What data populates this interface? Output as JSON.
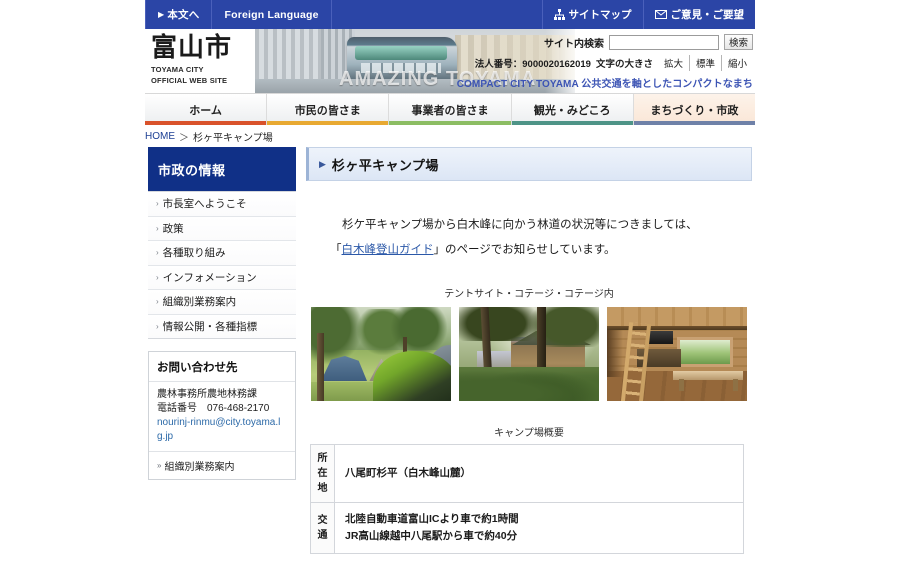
{
  "utility_bar": {
    "left_items": [
      {
        "label": "本文へ",
        "icon": "caret-right-icon"
      },
      {
        "label": "Foreign Language",
        "icon": ""
      }
    ],
    "right_items": [
      {
        "label": "サイトマップ",
        "icon": "sitemap-icon"
      },
      {
        "label": "ご意見・ご要望",
        "icon": "mail-icon"
      }
    ],
    "background": "#2b45a6"
  },
  "masthead": {
    "logo_kanji": "富山市",
    "logo_en_line1": "TOYAMA CITY",
    "logo_en_line2": "OFFICIAL WEB SITE",
    "banner_text": "AMAZING TOYAMA",
    "search": {
      "label": "サイト内検索",
      "value": "",
      "placeholder": "",
      "button_label": "検索"
    },
    "corporate_number": "法人番号：9000020162019",
    "text_size_label": "文字の大きさ",
    "text_size_buttons": [
      "拡大",
      "標準",
      "縮小"
    ],
    "tagline": "COMPACT CITY TOYAMA 公共交通を軸としたコンパクトなまちづくり",
    "tagline_color": "#3c54b4"
  },
  "global_nav": {
    "items": [
      {
        "label": "ホーム",
        "bar_color": "#d9522b",
        "active": false
      },
      {
        "label": "市民の皆さま",
        "bar_color": "#e8a932",
        "active": false
      },
      {
        "label": "事業者の皆さま",
        "bar_color": "#8cbd63",
        "active": false
      },
      {
        "label": "観光・みどころ",
        "bar_color": "#4e9487",
        "active": false
      },
      {
        "label": "まちづくり・市政",
        "bar_color": "#6f81a8",
        "active": true
      }
    ]
  },
  "breadcrumb": {
    "home_label": "HOME",
    "separator": "＞",
    "current": "杉ヶ平キャンプ場"
  },
  "sidebar": {
    "header": "市政の情報",
    "header_color": "#103087",
    "items": [
      {
        "label": "市長室へようこそ"
      },
      {
        "label": "政策"
      },
      {
        "label": "各種取り組み"
      },
      {
        "label": "インフォメーション"
      },
      {
        "label": "組織別業務案内"
      },
      {
        "label": "情報公開・各種指標"
      }
    ],
    "contact": {
      "header": "お問い合わせ先",
      "department": "農林事務所農地林務課",
      "phone": "電話番号　076-468-2170",
      "email": "nourinj-rinmu@city.toyama.lg.jp",
      "link_label": "組織別業務案内"
    }
  },
  "main": {
    "page_title": "杉ヶ平キャンプ場",
    "paragraph_line1": "杉ケ平キャンプ場から白木峰に向かう林道の状況等につきましては、",
    "paragraph_line2_pre": "「",
    "paragraph_link": "白木峰登山ガイド",
    "paragraph_line2_post": "」のページでお知らせしています。",
    "photo_caption": "テントサイト・コテージ・コテージ内",
    "photos": [
      {
        "alt": "テントサイト"
      },
      {
        "alt": "コテージ"
      },
      {
        "alt": "コテージ内"
      }
    ],
    "table_caption": "キャンプ場概要",
    "table_rows": [
      {
        "header": "所在地",
        "header_chars": [
          "所",
          "在",
          "地"
        ],
        "values": [
          "八尾町杉平（白木峰山麓）"
        ]
      },
      {
        "header": "交通",
        "header_chars": [
          "交",
          "通"
        ],
        "values": [
          "北陸自動車道富山ICより車で約1時間",
          "JR高山線越中八尾駅から車で約40分"
        ]
      }
    ]
  }
}
